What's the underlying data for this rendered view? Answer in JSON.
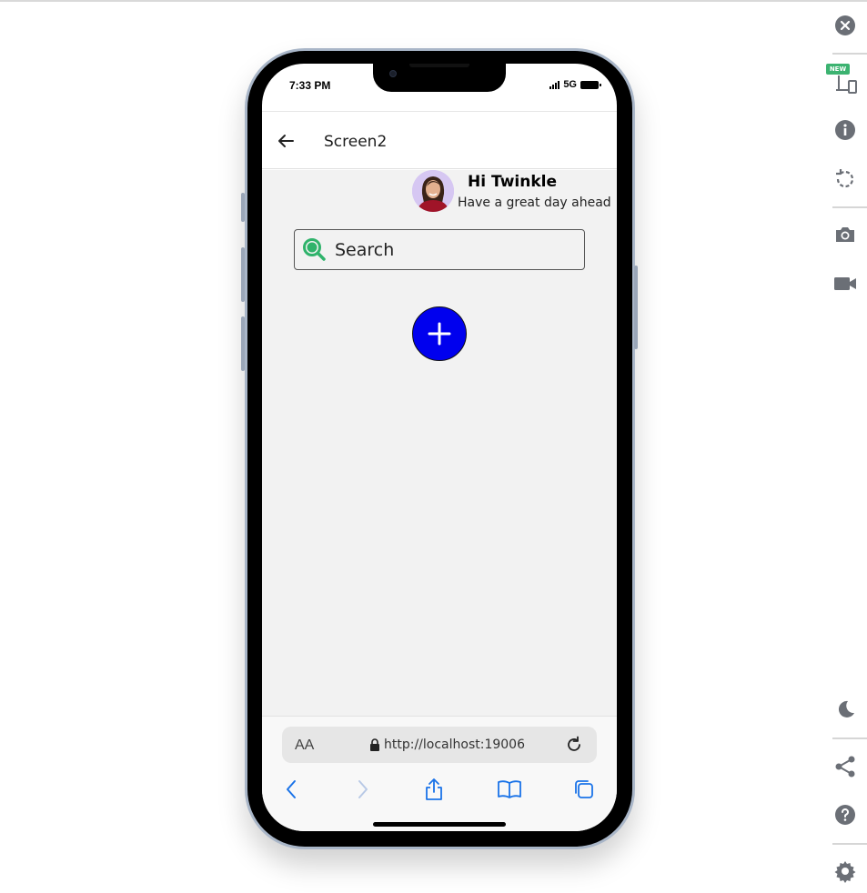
{
  "status_bar": {
    "time": "7:33 PM",
    "network": "5G"
  },
  "header": {
    "title": "Screen2"
  },
  "greeting": {
    "name": "Hi Twinkle",
    "subtitle": "Have a great day ahead"
  },
  "search": {
    "placeholder": "Search",
    "value": ""
  },
  "browser": {
    "text_size_label": "AA",
    "url": "http://localhost:19006"
  },
  "toolbar": {
    "new_badge": "NEW"
  },
  "colors": {
    "add_button": "#0000ee",
    "search_icon": "#2fb36b",
    "safari_blue": "#1a73e8",
    "toolbar_icon": "#6b6f76"
  },
  "icons": [
    "close-icon",
    "device-icon",
    "info-icon",
    "rotate-icon",
    "camera-icon",
    "video-icon",
    "moon-icon",
    "share-icon",
    "help-icon",
    "gear-icon"
  ]
}
